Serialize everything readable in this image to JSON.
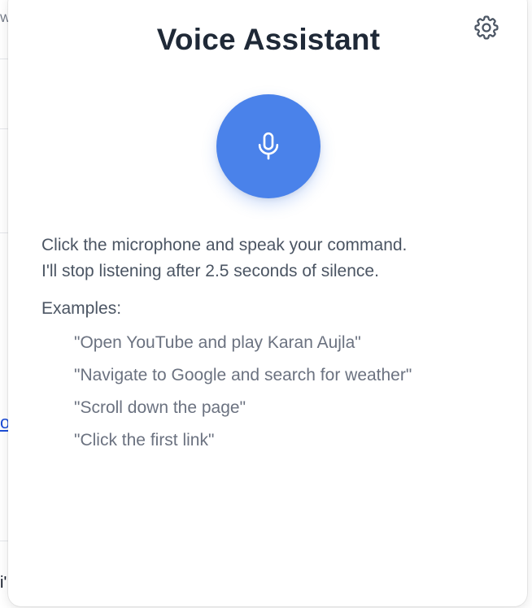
{
  "background": {
    "top_text_fragment": "W",
    "link_fragment": "o",
    "bottom_text_fragment": "i'"
  },
  "panel": {
    "title": "Voice Assistant",
    "settings_icon": "gear-icon",
    "mic_icon": "microphone-icon",
    "accent_color": "#4a82ea",
    "instructions": [
      "Click the microphone and speak your command.",
      "I'll stop listening after 2.5 seconds of silence."
    ],
    "examples_heading": "Examples:",
    "examples": [
      "\"Open YouTube and play Karan Aujla\"",
      "\"Navigate to Google and search for weather\"",
      "\"Scroll down the page\"",
      "\"Click the first link\""
    ]
  }
}
